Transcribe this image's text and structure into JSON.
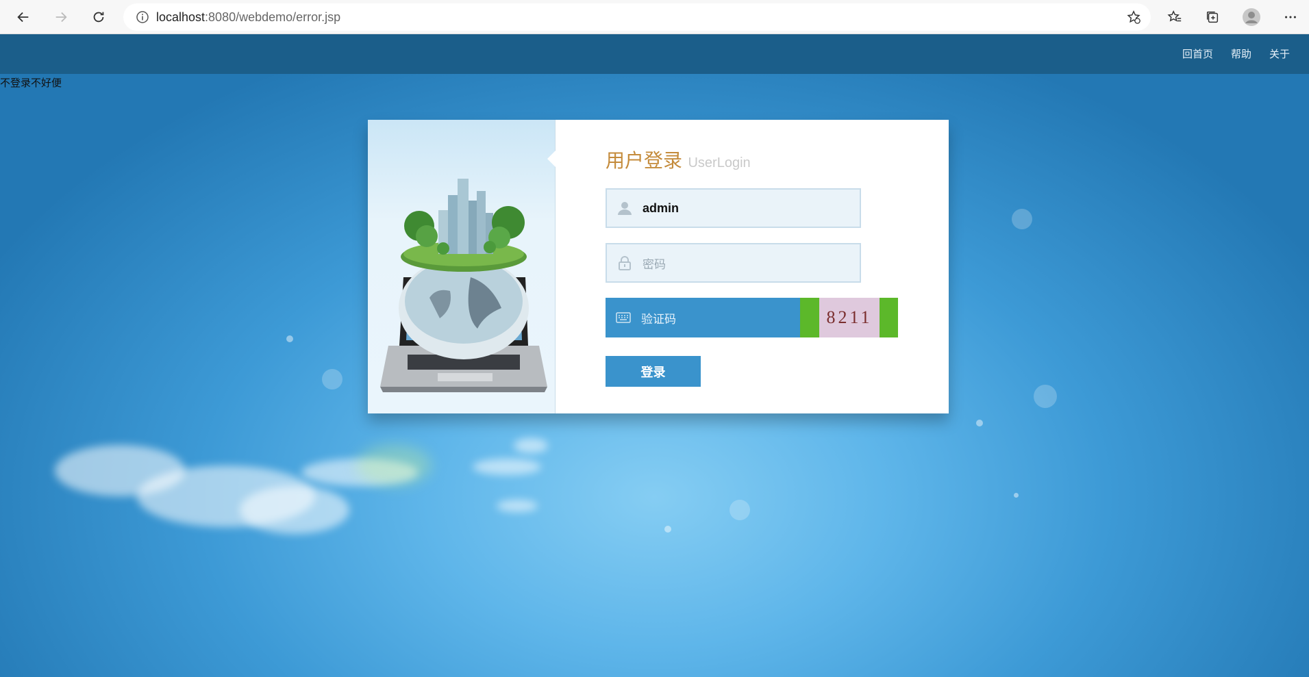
{
  "browser": {
    "url_host": "localhost",
    "url_path": ":8080/webdemo/error.jsp"
  },
  "topbar": {
    "links": [
      "回首页",
      "帮助",
      "关于"
    ]
  },
  "notice": "不登录不好便",
  "login": {
    "title_cn": "用户登录",
    "title_en": "UserLogin",
    "username_value": "admin",
    "password_placeholder": "密码",
    "captcha_placeholder": "验证码",
    "captcha_code": "8211",
    "submit_label": "登录"
  },
  "colors": {
    "topbar": "#1b5e8a",
    "primary": "#3a93cc",
    "title": "#c48b3b",
    "captcha_bg": "#5cb82a"
  }
}
